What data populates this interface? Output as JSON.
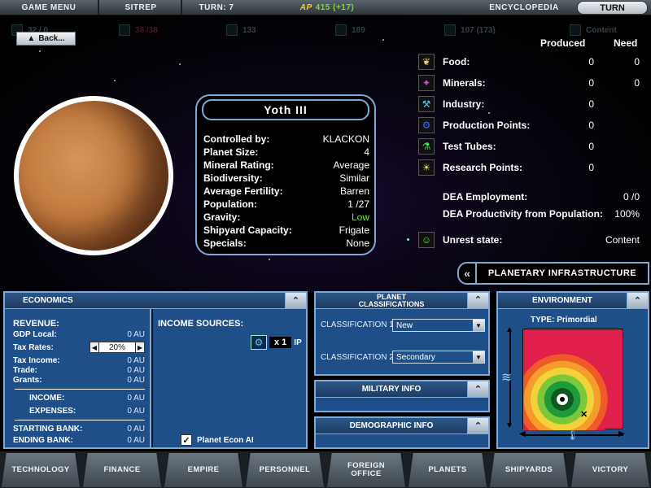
{
  "topbar": {
    "game_menu": "GAME MENU",
    "sitrep": "SITREP",
    "turn_label": "TURN: 7",
    "ap_icon": "AP",
    "ap_value": "415 (+17)",
    "encyclopedia": "ENCYCLOPEDIA",
    "turn_button": "TURN"
  },
  "resource_strip": {
    "food": "32 / 0",
    "minerals": "38 /38",
    "industry": "133",
    "production": "189",
    "research": "107 (173)",
    "content": "Content"
  },
  "back_button": "Back...",
  "planet": {
    "name": "Yoth III",
    "rows": [
      {
        "label": "Controlled by:",
        "value": "KLACKON"
      },
      {
        "label": "Planet Size:",
        "value": "4"
      },
      {
        "label": "Mineral Rating:",
        "value": "Average"
      },
      {
        "label": "Biodiversity:",
        "value": "Similar"
      },
      {
        "label": "Average Fertility:",
        "value": "Barren"
      },
      {
        "label": "Population:",
        "value": "1 /27"
      },
      {
        "label": "Gravity:",
        "value": "Low"
      },
      {
        "label": "Shipyard Capacity:",
        "value": "Frigate"
      },
      {
        "label": "Specials:",
        "value": "None"
      }
    ]
  },
  "stats": {
    "produced_header": "Produced",
    "need_header": "Need",
    "rows": [
      {
        "icon": "wheat-icon",
        "label": "Food:",
        "produced": "0",
        "need": "0",
        "color": "#e8d36a"
      },
      {
        "icon": "crystal-icon",
        "label": "Minerals:",
        "produced": "0",
        "need": "0",
        "color": "#d04ae0"
      },
      {
        "icon": "wrench-icon",
        "label": "Industry:",
        "produced": "0",
        "need": "",
        "color": "#5ac8e8"
      },
      {
        "icon": "gear-icon",
        "label": "Production Points:",
        "produced": "0",
        "need": "",
        "color": "#3a6cf0"
      },
      {
        "icon": "test-tube-icon",
        "label": "Test Tubes:",
        "produced": "0",
        "need": "",
        "color": "#4ae05a"
      },
      {
        "icon": "lightbulb-icon",
        "label": "Research Points:",
        "produced": "0",
        "need": "",
        "color": "#d8e04a"
      }
    ],
    "dea_employment_label": "DEA Employment:",
    "dea_employment_value": "0 /0",
    "dea_productivity_label": "DEA Productivity from Population:",
    "dea_productivity_value": "100%",
    "unrest_label": "Unrest state:",
    "unrest_value": "Content"
  },
  "infrastructure_button": "PLANETARY INFRASTRUCTURE",
  "economics": {
    "title": "ECONOMICS",
    "revenue_label": "REVENUE:",
    "gdp_label": "GDP Local:",
    "gdp_value": "0 AU",
    "tax_label": "Tax Rates:",
    "tax_value": "20%",
    "tax_income_label": "Tax Income:",
    "tax_income_value": "0 AU",
    "trade_label": "Trade:",
    "trade_value": "0 AU",
    "grants_label": "Grants:",
    "grants_value": "0 AU",
    "income_label": "INCOME:",
    "income_value": "0 AU",
    "expenses_label": "EXPENSES:",
    "expenses_value": "0 AU",
    "starting_bank_label": "STARTING BANK:",
    "starting_bank_value": "0 AU",
    "ending_bank_label": "ENDING BANK:",
    "ending_bank_value": "0 AU",
    "income_sources_label": "INCOME SOURCES:",
    "income_source_multiplier": "x 1",
    "income_source_unit": "IP",
    "econ_ai_label": "Planet Econ AI",
    "econ_ai_checked": true
  },
  "classifications": {
    "title_line1": "PLANET",
    "title_line2": "CLASSIFICATIONS",
    "class1_label": "CLASSIFICATION 1",
    "class1_value": "New",
    "class2_label": "CLASSIFICATION 2",
    "class2_value": "Secondary"
  },
  "military": {
    "title": "MILITARY INFO"
  },
  "demographic": {
    "title": "DEMOGRAPHIC INFO"
  },
  "environment": {
    "title": "ENVIRONMENT",
    "type_label": "TYPE:",
    "type_value": "Primordial",
    "rings": [
      "#e0204a",
      "#f05a28",
      "#f59c2a",
      "#f2d23a",
      "#7cc83a",
      "#1f9a3a",
      "#0a5a22"
    ]
  },
  "bottom_nav": [
    "TECHNOLOGY",
    "FINANCE",
    "EMPIRE",
    "PERSONNEL",
    "FOREIGN OFFICE",
    "PLANETS",
    "SHIPYARDS",
    "VICTORY"
  ]
}
